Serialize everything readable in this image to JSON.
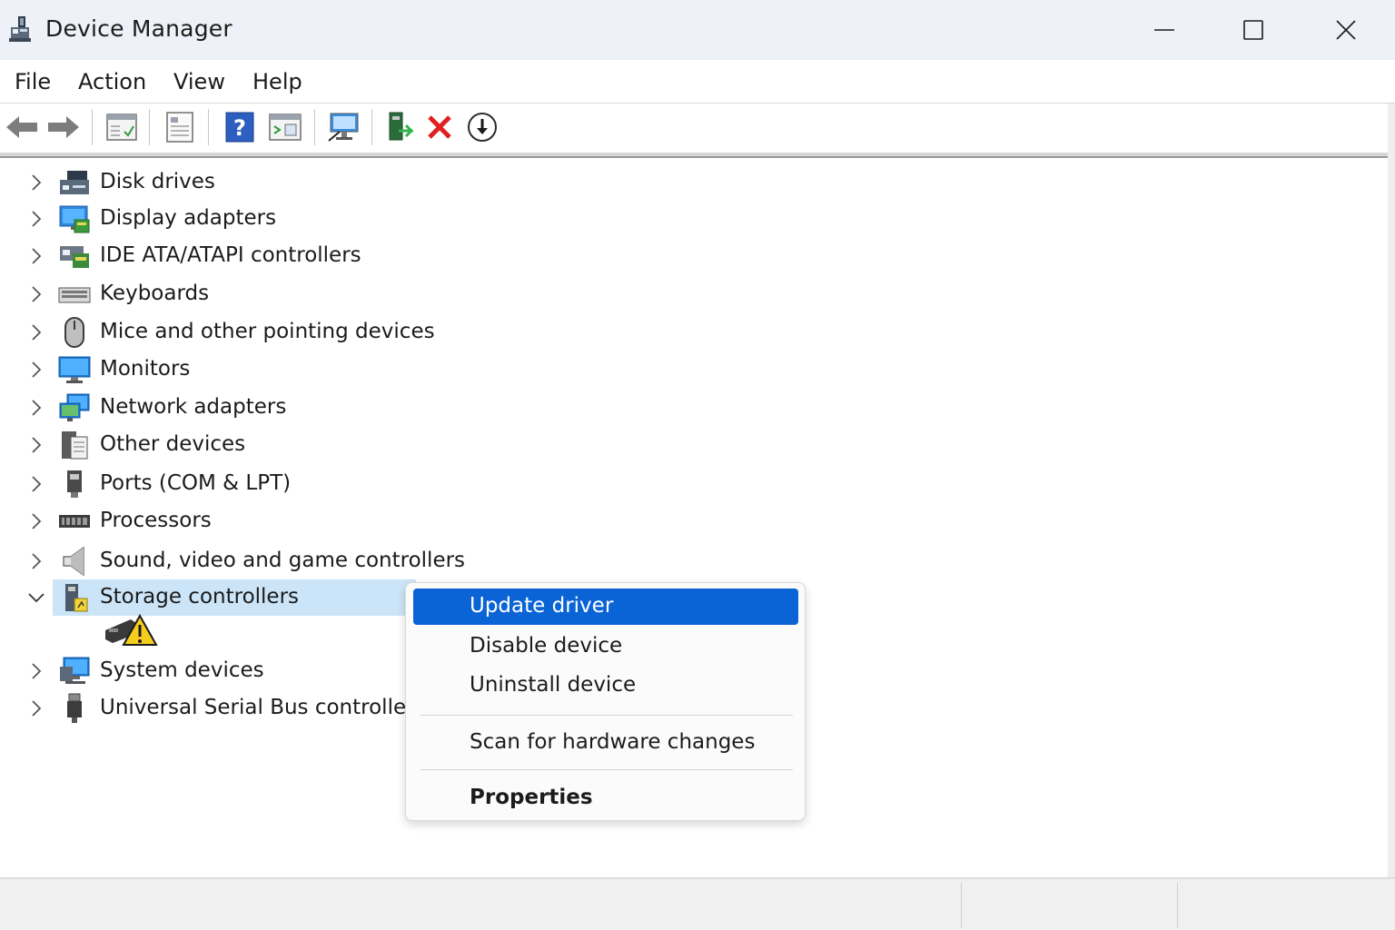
{
  "window": {
    "title": "Device Manager",
    "app_icon": "device-manager-icon",
    "controls": [
      "minimize-icon",
      "maximize-icon",
      "close-icon"
    ]
  },
  "menu": {
    "items": [
      "File",
      "Action",
      "View",
      "Help"
    ]
  },
  "toolbar": {
    "icons": [
      "back-arrow-icon",
      "forward-arrow-icon",
      "show-hide-console-tree-icon",
      "properties-icon",
      "help-icon",
      "action-pane-icon",
      "scan-hardware-icon",
      "update-driver-icon",
      "uninstall-device-icon",
      "enable-device-icon"
    ]
  },
  "tree": {
    "nodes": [
      {
        "label": "Disk drives",
        "icon": "disk-drive-icon",
        "expanded": false
      },
      {
        "label": "Display adapters",
        "icon": "display-adapter-icon",
        "expanded": false
      },
      {
        "label": "IDE ATA/ATAPI controllers",
        "icon": "ide-controller-icon",
        "expanded": false
      },
      {
        "label": "Keyboards",
        "icon": "keyboard-icon",
        "expanded": false
      },
      {
        "label": "Mice and other pointing devices",
        "icon": "mouse-icon",
        "expanded": false
      },
      {
        "label": "Monitors",
        "icon": "monitor-icon",
        "expanded": false
      },
      {
        "label": "Network adapters",
        "icon": "network-adapter-icon",
        "expanded": false
      },
      {
        "label": "Other devices",
        "icon": "other-devices-icon",
        "expanded": false
      },
      {
        "label": "Ports (COM & LPT)",
        "icon": "port-icon",
        "expanded": false
      },
      {
        "label": "Processors",
        "icon": "processor-icon",
        "expanded": false
      },
      {
        "label": "Sound, video and game controllers",
        "icon": "speaker-icon",
        "expanded": false
      },
      {
        "label": "Storage controllers",
        "icon": "storage-controller-icon",
        "expanded": true,
        "selected": true
      },
      {
        "label": "System devices",
        "icon": "system-devices-icon",
        "expanded": false
      },
      {
        "label": "Universal Serial Bus controllers",
        "icon": "usb-icon",
        "expanded": false
      }
    ],
    "child_icon": "warning-device-icon"
  },
  "context_menu": {
    "items": [
      {
        "label": "Update driver",
        "highlighted": true
      },
      {
        "label": "Disable device"
      },
      {
        "label": "Uninstall device"
      },
      {
        "label": "Scan for hardware changes"
      },
      {
        "label": "Properties",
        "bold": true
      }
    ]
  },
  "colors": {
    "titlebar": "#eef1f7",
    "selection": "#cce4f7",
    "menu_highlight": "#0a64d6"
  }
}
